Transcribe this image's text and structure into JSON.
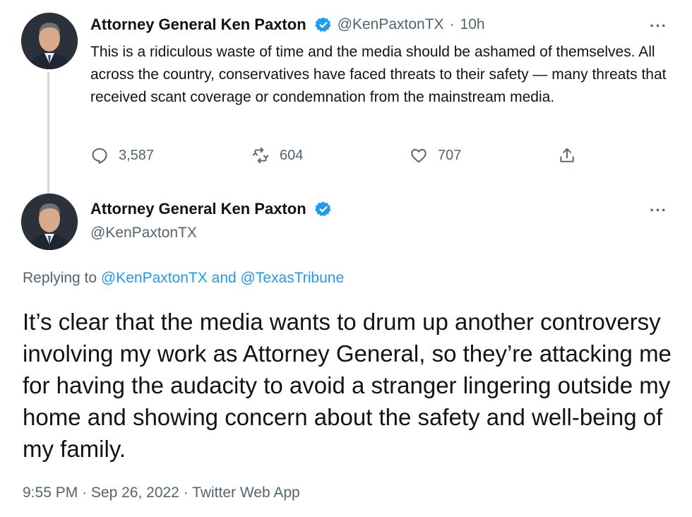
{
  "tweet1": {
    "author_name": "Attorney General Ken Paxton",
    "handle": "@KenPaxtonTX",
    "separator": "·",
    "time": "10h",
    "text": "This is a ridiculous waste of time and the media should be ashamed of themselves. All across the country, conservatives have faced threats to their safety — many threats that received scant coverage or condemnation from the mainstream media.",
    "replies": "3,587",
    "retweets": "604",
    "likes": "707",
    "more_label": "···"
  },
  "tweet2": {
    "author_name": "Attorney General Ken Paxton",
    "handle": "@KenPaxtonTX",
    "more_label": "···",
    "replying_prefix": "Replying to",
    "replying_user1": "@KenPaxtonTX",
    "replying_and": "and",
    "replying_user2": "@TexasTribune",
    "text": "It’s clear that the media wants to drum up another controversy involving my work as Attorney General, so they’re attacking me for having the audacity to avoid a stranger lingering outside my home and showing concern about the safety and well-being of my family.",
    "time": "9:55 PM",
    "separator": "·",
    "date": "Sep 26, 2022",
    "source": "Twitter Web App"
  },
  "colors": {
    "link_blue": "#1d9bf0",
    "secondary_text": "#536471",
    "primary_text": "#0f1419",
    "thread_line": "#cfd9de"
  },
  "icons": [
    "reply-icon",
    "retweet-icon",
    "like-icon",
    "share-icon",
    "verified-icon",
    "more-icon"
  ]
}
